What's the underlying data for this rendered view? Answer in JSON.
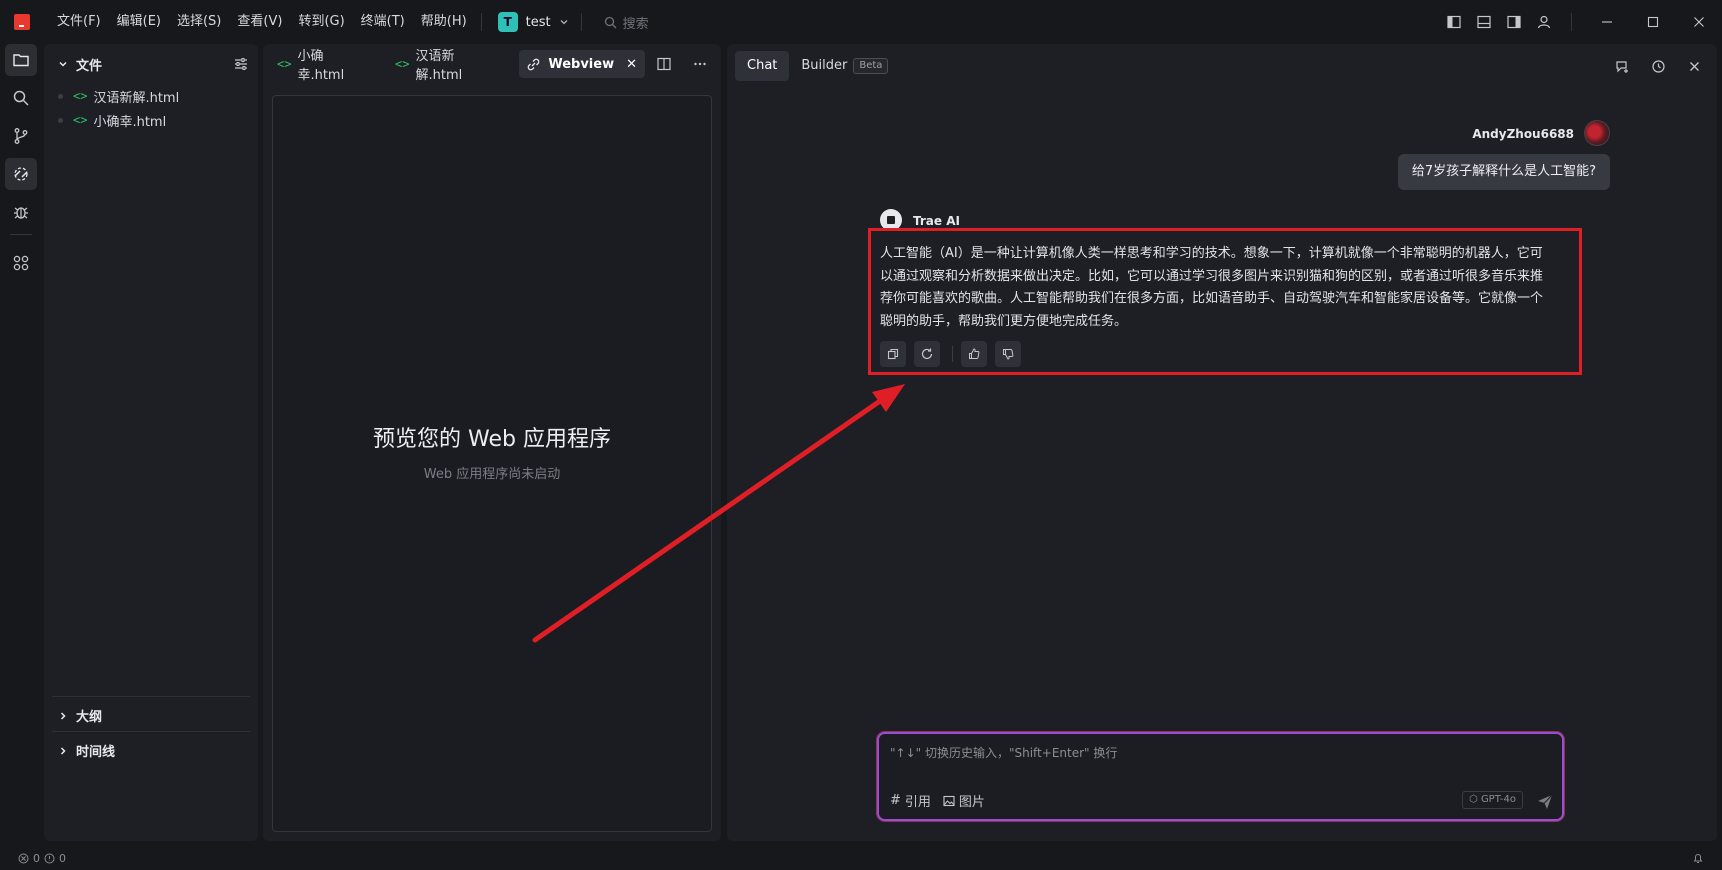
{
  "menu": [
    "文件(F)",
    "编辑(E)",
    "选择(S)",
    "查看(V)",
    "转到(G)",
    "终端(T)",
    "帮助(H)"
  ],
  "project": {
    "initial": "T",
    "name": "test"
  },
  "search": {
    "placeholder": "搜索"
  },
  "explorer": {
    "title": "文件",
    "files": [
      "汉语新解.html",
      "小确幸.html"
    ],
    "sections": [
      "大纲",
      "时间线"
    ]
  },
  "editor": {
    "tabs": [
      "小确幸.html",
      "汉语新解.html",
      "Webview"
    ],
    "webview": {
      "title": "预览您的 Web 应用程序",
      "subtitle": "Web 应用程序尚未启动"
    }
  },
  "chat": {
    "tabs": {
      "chat": "Chat",
      "builder": "Builder",
      "beta": "Beta"
    },
    "user": {
      "name": "AndyZhou6688",
      "message": "给7岁孩子解释什么是人工智能?"
    },
    "ai": {
      "name": "Trae AI",
      "message": "人工智能（AI）是一种让计算机像人类一样思考和学习的技术。想象一下，计算机就像一个非常聪明的机器人，它可以通过观察和分析数据来做出决定。比如，它可以通过学习很多图片来识别猫和狗的区别，或者通过听很多音乐来推荐你可能喜欢的歌曲。人工智能帮助我们在很多方面，比如语音助手、自动驾驶汽车和智能家居设备等。它就像一个聪明的助手，帮助我们更方便地完成任务。"
    },
    "input": {
      "placeholder": "\"↑↓\" 切换历史输入，\"Shift+Enter\" 换行",
      "ref_label": "引用",
      "image_label": "图片",
      "model": "GPT-4o"
    }
  },
  "status": {
    "errors": "0",
    "warnings": "0"
  },
  "colors": {
    "highlight": "#e01e26",
    "accent": "#e8392f",
    "project_avatar": "#2fc1b8",
    "file_icon": "#2fc16a"
  }
}
